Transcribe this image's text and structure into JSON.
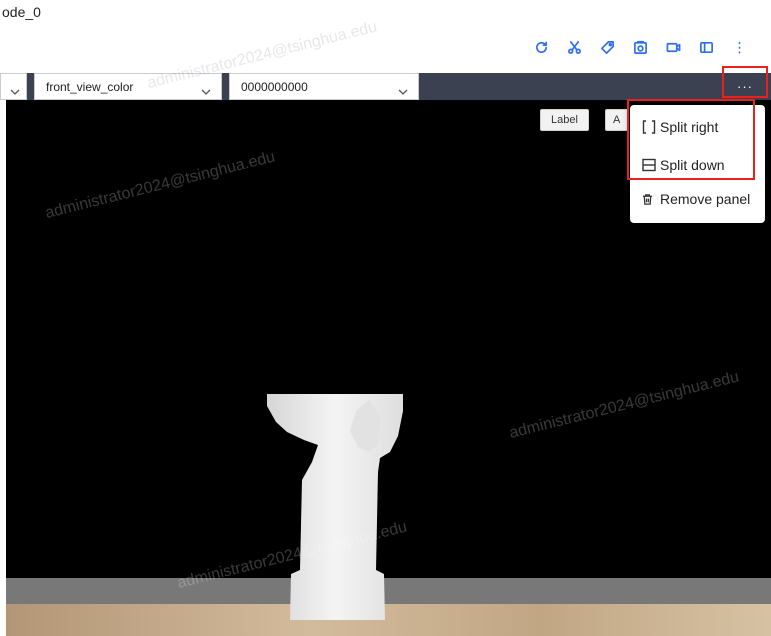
{
  "window": {
    "title": "ode_0"
  },
  "toolbar": {
    "buttons": [
      "refresh-icon",
      "scissors-icon",
      "tag-icon",
      "camera-icon",
      "video-icon",
      "panel-icon",
      "more-vertical-icon"
    ],
    "accent_color": "#2f6fed"
  },
  "panel_bar": {
    "selects": [
      "",
      "front_view_color",
      "0000000000"
    ],
    "more_label": "···"
  },
  "viewer": {
    "chips": {
      "label": "Label",
      "auto": "A"
    }
  },
  "menu": {
    "items": [
      {
        "label": "Split right",
        "icon": "split-right-icon"
      },
      {
        "label": "Split down",
        "icon": "split-down-icon"
      },
      {
        "label": "Remove panel",
        "icon": "trash-icon"
      }
    ]
  },
  "watermark": "administrator2024@tsinghua.edu"
}
